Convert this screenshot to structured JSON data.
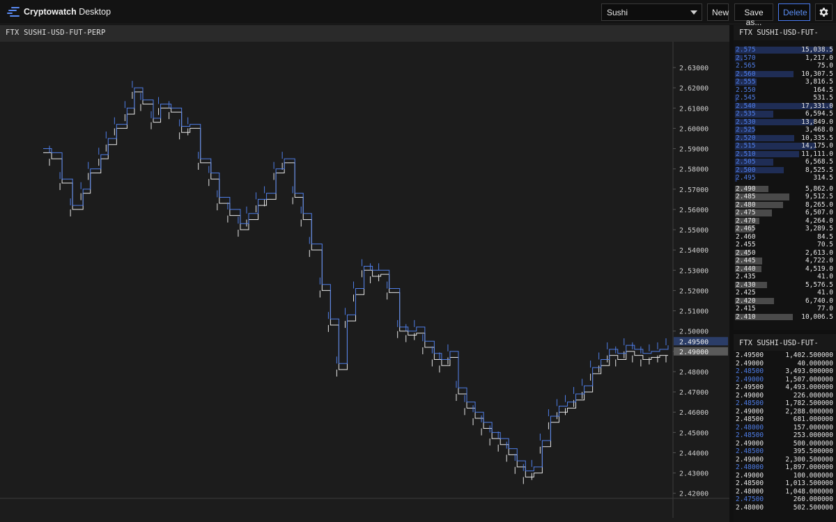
{
  "app": {
    "brand": "Cryptowatch",
    "product": "Desktop",
    "layout_select": "Sushi",
    "buttons": {
      "new": "New",
      "save_as": "Save as...",
      "delete": "Delete"
    },
    "icons": {
      "logo": "cryptowatch-logo-icon",
      "dropdown": "chevron-down-icon",
      "settings": "gear-icon"
    },
    "colors": {
      "accent": "#4a7cf2",
      "bid_bar": "#1f2d55",
      "ask_bar": "#4a4a4a",
      "buy": "#4f7ee8",
      "sell": "#e8e8e8"
    }
  },
  "chart": {
    "title": "FTX SUSHI-USD-FUT-PERP",
    "badges": {
      "ask": "2.49500",
      "bid": "2.49000"
    }
  },
  "chart_data": {
    "type": "line",
    "title": "FTX SUSHI-USD-FUT-PERP",
    "y_ticks": [
      "2.63000",
      "2.62000",
      "2.61000",
      "2.60000",
      "2.59000",
      "2.58000",
      "2.57000",
      "2.56000",
      "2.55000",
      "2.54000",
      "2.53000",
      "2.52000",
      "2.51000",
      "2.50000",
      "2.49000",
      "2.48000",
      "2.47000",
      "2.46000",
      "2.45000",
      "2.44000",
      "2.43000",
      "2.42000"
    ],
    "ylim": [
      2.4175,
      2.6355
    ],
    "x": [
      0,
      8,
      18,
      28,
      38,
      45,
      55,
      62,
      70,
      80,
      87,
      95,
      105,
      112,
      122,
      132,
      140,
      150,
      160,
      168,
      178,
      188,
      196,
      205,
      213,
      222,
      230,
      240,
      248,
      256,
      266,
      274,
      282,
      290,
      298,
      306,
      314,
      322,
      330,
      340,
      348,
      356,
      364,
      373,
      380,
      388,
      396,
      404
    ],
    "series": [
      {
        "values": [
          2.588,
          2.585,
          2.573,
          2.56,
          2.568,
          2.578,
          2.585,
          2.592,
          2.6,
          2.607,
          2.618,
          2.612,
          2.603,
          2.61,
          2.608,
          2.598,
          2.6,
          2.583,
          2.575,
          2.563,
          2.557,
          2.55,
          2.555,
          2.562,
          2.565,
          2.578,
          2.583,
          2.566,
          2.555,
          2.54,
          2.52,
          2.503,
          2.481,
          2.505,
          2.518,
          2.53,
          2.527,
          2.528,
          2.519,
          2.5,
          2.498,
          2.499,
          2.492,
          2.486,
          2.483,
          2.487,
          2.469,
          2.462
        ]
      },
      {
        "values": [
          2.59,
          2.588,
          2.575,
          2.562,
          2.57,
          2.58,
          2.587,
          2.595,
          2.602,
          2.61,
          2.62,
          2.614,
          2.605,
          2.612,
          2.61,
          2.601,
          2.602,
          2.585,
          2.578,
          2.566,
          2.56,
          2.553,
          2.558,
          2.565,
          2.568,
          2.58,
          2.585,
          2.568,
          2.558,
          2.543,
          2.523,
          2.506,
          2.484,
          2.508,
          2.521,
          2.532,
          2.53,
          2.53,
          2.521,
          2.502,
          2.5,
          2.502,
          2.495,
          2.489,
          2.486,
          2.49,
          2.472,
          2.465
        ]
      }
    ],
    "x2": [
      404,
      412,
      420,
      428,
      436,
      444,
      452,
      460,
      468,
      476,
      484,
      492,
      500,
      508,
      516,
      524,
      532,
      540,
      548,
      556,
      564,
      572,
      580,
      588,
      596
    ],
    "series2": [
      {
        "values": [
          2.462,
          2.457,
          2.452,
          2.447,
          2.444,
          2.439,
          2.433,
          2.428,
          2.43,
          2.443,
          2.455,
          2.46,
          2.462,
          2.466,
          2.47,
          2.479,
          2.483,
          2.488,
          2.486,
          2.49,
          2.488,
          2.486,
          2.487,
          2.488,
          2.488
        ]
      },
      {
        "values": [
          2.465,
          2.46,
          2.455,
          2.45,
          2.447,
          2.442,
          2.436,
          2.431,
          2.433,
          2.446,
          2.458,
          2.463,
          2.465,
          2.469,
          2.473,
          2.482,
          2.486,
          2.491,
          2.489,
          2.493,
          2.491,
          2.489,
          2.49,
          2.491,
          2.493
        ]
      }
    ]
  },
  "orderbook": {
    "title": "FTX SUSHI-USD-FUT-",
    "asks": [
      {
        "price": "2.575",
        "size": "15,038.5",
        "fill": 1.0
      },
      {
        "price": "2.570",
        "size": "1,217.0",
        "fill": 0.08
      },
      {
        "price": "2.565",
        "size": "75.0",
        "fill": 0.0
      },
      {
        "price": "2.560",
        "size": "10,307.5",
        "fill": 0.6
      },
      {
        "price": "2.555",
        "size": "3,816.5",
        "fill": 0.22
      },
      {
        "price": "2.550",
        "size": "164.5",
        "fill": 0.0
      },
      {
        "price": "2.545",
        "size": "531.5",
        "fill": 0.02
      },
      {
        "price": "2.540",
        "size": "17,331.0",
        "fill": 1.0
      },
      {
        "price": "2.535",
        "size": "6,594.5",
        "fill": 0.39
      },
      {
        "price": "2.530",
        "size": "13,849.0",
        "fill": 0.81
      },
      {
        "price": "2.525",
        "size": "3,468.0",
        "fill": 0.2
      },
      {
        "price": "2.520",
        "size": "10,335.5",
        "fill": 0.61
      },
      {
        "price": "2.515",
        "size": "14,175.0",
        "fill": 0.83
      },
      {
        "price": "2.510",
        "size": "11,111.0",
        "fill": 0.66
      },
      {
        "price": "2.505",
        "size": "6,568.5",
        "fill": 0.39
      },
      {
        "price": "2.500",
        "size": "8,525.5",
        "fill": 0.5
      },
      {
        "price": "2.495",
        "size": "314.5",
        "fill": 0.02
      }
    ],
    "bids": [
      {
        "price": "2.490",
        "size": "5,862.0",
        "fill": 0.34
      },
      {
        "price": "2.485",
        "size": "9,512.5",
        "fill": 0.56
      },
      {
        "price": "2.480",
        "size": "8,265.0",
        "fill": 0.49
      },
      {
        "price": "2.475",
        "size": "6,507.0",
        "fill": 0.38
      },
      {
        "price": "2.470",
        "size": "4,264.0",
        "fill": 0.25
      },
      {
        "price": "2.465",
        "size": "3,289.5",
        "fill": 0.19
      },
      {
        "price": "2.460",
        "size": "84.5",
        "fill": 0.0
      },
      {
        "price": "2.455",
        "size": "70.5",
        "fill": 0.0
      },
      {
        "price": "2.450",
        "size": "2,613.0",
        "fill": 0.15
      },
      {
        "price": "2.445",
        "size": "4,722.0",
        "fill": 0.28
      },
      {
        "price": "2.440",
        "size": "4,519.0",
        "fill": 0.27
      },
      {
        "price": "2.435",
        "size": "41.0",
        "fill": 0.0
      },
      {
        "price": "2.430",
        "size": "5,576.5",
        "fill": 0.33
      },
      {
        "price": "2.425",
        "size": "41.0",
        "fill": 0.0
      },
      {
        "price": "2.420",
        "size": "6,740.0",
        "fill": 0.4
      },
      {
        "price": "2.415",
        "size": "77.0",
        "fill": 0.0
      },
      {
        "price": "2.410",
        "size": "10,006.5",
        "fill": 0.59
      }
    ]
  },
  "trades": {
    "title": "FTX SUSHI-USD-FUT-",
    "rows": [
      {
        "price": "2.49500",
        "size": "1,402.500000",
        "side": "sell"
      },
      {
        "price": "2.49000",
        "size": "40.000000",
        "side": "sell"
      },
      {
        "price": "2.48500",
        "size": "3,493.000000",
        "side": "buy"
      },
      {
        "price": "2.49000",
        "size": "1,507.000000",
        "side": "buy"
      },
      {
        "price": "2.49500",
        "size": "4,493.000000",
        "side": "sell"
      },
      {
        "price": "2.49000",
        "size": "226.000000",
        "side": "sell"
      },
      {
        "price": "2.48500",
        "size": "1,782.500000",
        "side": "buy"
      },
      {
        "price": "2.49000",
        "size": "2,288.000000",
        "side": "sell"
      },
      {
        "price": "2.48500",
        "size": "681.000000",
        "side": "sell"
      },
      {
        "price": "2.48000",
        "size": "157.000000",
        "side": "buy"
      },
      {
        "price": "2.48500",
        "size": "253.000000",
        "side": "buy"
      },
      {
        "price": "2.49000",
        "size": "500.000000",
        "side": "sell"
      },
      {
        "price": "2.48500",
        "size": "395.500000",
        "side": "buy"
      },
      {
        "price": "2.49000",
        "size": "2,300.500000",
        "side": "sell"
      },
      {
        "price": "2.48000",
        "size": "1,897.000000",
        "side": "buy"
      },
      {
        "price": "2.49000",
        "size": "100.000000",
        "side": "sell"
      },
      {
        "price": "2.48500",
        "size": "1,013.500000",
        "side": "sell"
      },
      {
        "price": "2.48000",
        "size": "1,048.000000",
        "side": "sell"
      },
      {
        "price": "2.47500",
        "size": "260.000000",
        "side": "buy"
      },
      {
        "price": "2.48000",
        "size": "502.500000",
        "side": "sell"
      }
    ]
  }
}
